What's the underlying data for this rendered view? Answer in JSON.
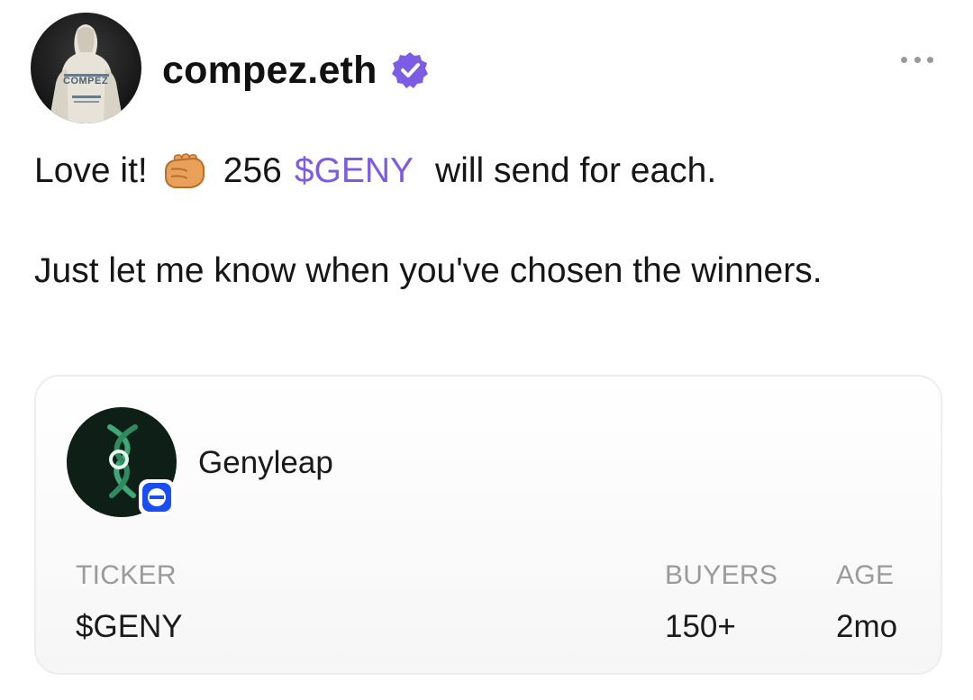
{
  "author": {
    "username": "compez.eth",
    "verified": true,
    "avatar_icon": "hoodie-avatar-icon",
    "avatar_text": "COMPEZ"
  },
  "post": {
    "line1_start": "Love it!",
    "line1_emoji": "oncoming-fist-emoji",
    "line1_amount": "256",
    "line1_ticker": "$GENY",
    "line1_end": "will send for each.",
    "paragraph2": "Just let me know when you've chosen the winners."
  },
  "token_card": {
    "name": "Genyleap",
    "logo_icon": "dna-helix-icon",
    "chain_badge_icon": "base-chain-icon",
    "ticker_label": "TICKER",
    "ticker_value": "$GENY",
    "buyers_label": "BUYERS",
    "buyers_value": "150+",
    "age_label": "AGE",
    "age_value": "2mo"
  },
  "colors": {
    "accent": "#7c5ce4",
    "verified": "#7c5ce4",
    "chain_badge": "#1a4ef5",
    "token_logo_bg": "#0d1f17",
    "token_logo_green": "#3fa878"
  }
}
